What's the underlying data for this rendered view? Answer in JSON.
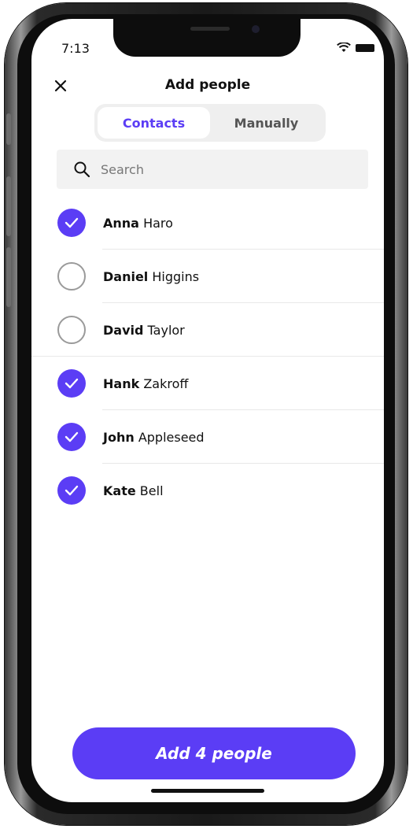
{
  "status_bar": {
    "time": "7:13"
  },
  "header": {
    "title": "Add people"
  },
  "tabs": [
    {
      "label": "Contacts",
      "active": true
    },
    {
      "label": "Manually",
      "active": false
    }
  ],
  "search": {
    "placeholder": "Search"
  },
  "contacts": [
    {
      "first": "Anna",
      "last": "Haro",
      "selected": true
    },
    {
      "first": "Daniel",
      "last": "Higgins",
      "selected": false
    },
    {
      "first": "David",
      "last": "Taylor",
      "selected": false
    },
    {
      "first": "Hank",
      "last": "Zakroff",
      "selected": true
    },
    {
      "first": "John",
      "last": "Appleseed",
      "selected": true
    },
    {
      "first": "Kate",
      "last": "Bell",
      "selected": true
    }
  ],
  "action": {
    "add_label": "Add 4 people"
  },
  "colors": {
    "accent": "#5b3df5",
    "text": "#111111",
    "muted": "#777777"
  }
}
